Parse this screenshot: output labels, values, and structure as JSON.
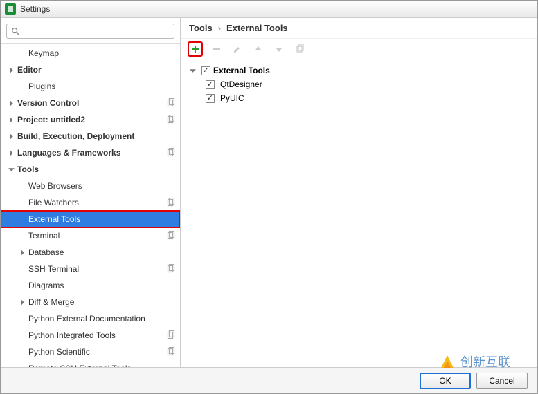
{
  "window": {
    "title": "Settings"
  },
  "search": {
    "placeholder": ""
  },
  "sidebar": {
    "items": [
      {
        "label": "Keymap",
        "bold": false,
        "expandable": false,
        "depth": 1
      },
      {
        "label": "Editor",
        "bold": true,
        "expandable": true,
        "depth": 0
      },
      {
        "label": "Plugins",
        "bold": false,
        "expandable": false,
        "depth": 1
      },
      {
        "label": "Version Control",
        "bold": true,
        "expandable": true,
        "depth": 0,
        "proj": true
      },
      {
        "label": "Project: untitled2",
        "bold": true,
        "expandable": true,
        "depth": 0,
        "proj": true
      },
      {
        "label": "Build, Execution, Deployment",
        "bold": true,
        "expandable": true,
        "depth": 0
      },
      {
        "label": "Languages & Frameworks",
        "bold": true,
        "expandable": true,
        "depth": 0,
        "proj": true
      },
      {
        "label": "Tools",
        "bold": true,
        "expandable": true,
        "depth": 0,
        "open": true
      },
      {
        "label": "Web Browsers",
        "bold": false,
        "expandable": false,
        "depth": 1
      },
      {
        "label": "File Watchers",
        "bold": false,
        "expandable": false,
        "depth": 1,
        "proj": true
      },
      {
        "label": "External Tools",
        "bold": false,
        "expandable": false,
        "depth": 1,
        "selected": true,
        "highlighted": true
      },
      {
        "label": "Terminal",
        "bold": false,
        "expandable": false,
        "depth": 1,
        "proj": true
      },
      {
        "label": "Database",
        "bold": false,
        "expandable": true,
        "depth": 1
      },
      {
        "label": "SSH Terminal",
        "bold": false,
        "expandable": false,
        "depth": 1,
        "proj": true
      },
      {
        "label": "Diagrams",
        "bold": false,
        "expandable": false,
        "depth": 1
      },
      {
        "label": "Diff & Merge",
        "bold": false,
        "expandable": true,
        "depth": 1
      },
      {
        "label": "Python External Documentation",
        "bold": false,
        "expandable": false,
        "depth": 1
      },
      {
        "label": "Python Integrated Tools",
        "bold": false,
        "expandable": false,
        "depth": 1,
        "proj": true
      },
      {
        "label": "Python Scientific",
        "bold": false,
        "expandable": false,
        "depth": 1,
        "proj": true
      },
      {
        "label": "Remote SSH External Tools",
        "bold": false,
        "expandable": false,
        "depth": 1
      }
    ]
  },
  "breadcrumb": {
    "root": "Tools",
    "current": "External Tools"
  },
  "toolbar": {
    "add": "add-icon",
    "remove": "remove-icon",
    "edit": "edit-icon",
    "up": "up-icon",
    "down": "down-icon",
    "copy": "copy-icon"
  },
  "content_tree": {
    "group": "External Tools",
    "items": [
      {
        "label": "QtDesigner",
        "checked": true
      },
      {
        "label": "PyUIC",
        "checked": true
      }
    ],
    "group_checked": true
  },
  "footer": {
    "ok": "OK",
    "cancel": "Cancel"
  },
  "watermark": "创新互联"
}
